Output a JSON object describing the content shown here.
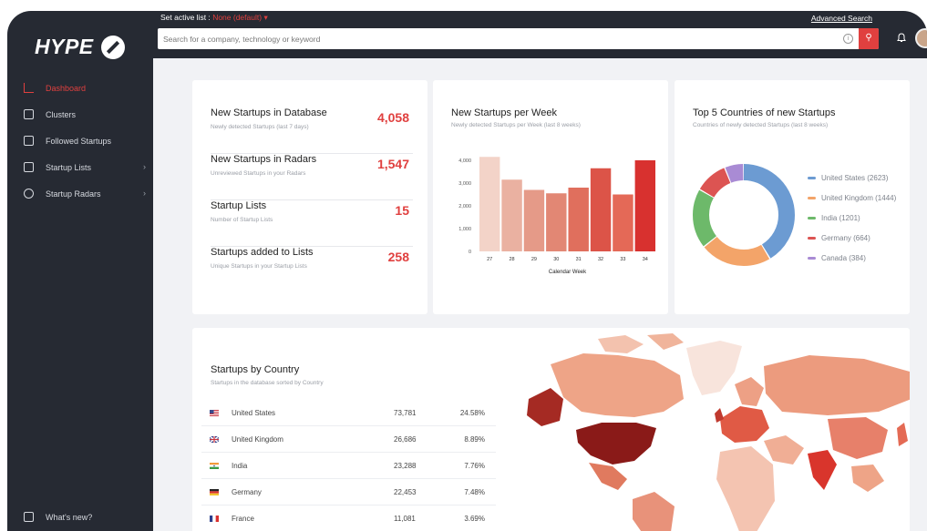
{
  "sidebar": {
    "logo": "HYPE",
    "items": [
      {
        "label": "Dashboard",
        "active": true
      },
      {
        "label": "Clusters"
      },
      {
        "label": "Followed Startups"
      },
      {
        "label": "Startup Lists",
        "chevron": "›"
      },
      {
        "label": "Startup Radars",
        "chevron": "›"
      }
    ],
    "whats_new": "What's new?"
  },
  "topbar": {
    "active_list_label": "Set active list :",
    "active_list_value": "None (default)",
    "active_list_caret": "▾",
    "advanced_search": "Advanced Search",
    "search_placeholder": "Search for a company, technology or keyword",
    "info_glyph": "i",
    "search_glyph": "⚲"
  },
  "stats": [
    {
      "title": "New Startups in Database",
      "sub": "Newly detected Startups (last 7 days)",
      "value": "4,058"
    },
    {
      "title": "New Startups in Radars",
      "sub": "Unreviewed Startups in your Radars",
      "value": "1,547"
    },
    {
      "title": "Startup Lists",
      "sub": "Number of Startup Lists",
      "value": "15"
    },
    {
      "title": "Startups added to Lists",
      "sub": "Unique Startups in your Startup Lists",
      "value": "258"
    }
  ],
  "weekly": {
    "title": "New Startups per Week",
    "sub": "Newly detected Startups per Week (last 8 weeks)",
    "xlabel": "Calendar Week",
    "ytick_labels": [
      "0",
      "1,000",
      "2,000",
      "3,000",
      "4,000"
    ],
    "chart_data": {
      "type": "bar",
      "categories": [
        "27",
        "28",
        "29",
        "30",
        "31",
        "32",
        "33",
        "34"
      ],
      "values": [
        4150,
        3150,
        2700,
        2550,
        2800,
        3650,
        2500,
        4000
      ],
      "ylim": [
        0,
        4000
      ],
      "xlabel": "Calendar Week",
      "colors": [
        "#f3d3c8",
        "#eab1a1",
        "#e59a88",
        "#e28774",
        "#e06f5d",
        "#dc5448",
        "#e46957",
        "#d8312f"
      ]
    }
  },
  "countries_top5": {
    "title": "Top 5 Countries of new Startups",
    "sub": "Countries of newly detected Startups (last 8 weeks)",
    "chart_data": {
      "type": "pie",
      "categories": [
        "United States",
        "United Kingdom",
        "India",
        "Germany",
        "Canada"
      ],
      "values": [
        2623,
        1444,
        1201,
        664,
        384
      ],
      "colors": [
        "#6c9bd2",
        "#f3a469",
        "#6db96a",
        "#dc5452",
        "#a98bd4"
      ]
    },
    "legend": [
      {
        "label": "United States (2623)",
        "color": "#6c9bd2"
      },
      {
        "label": "United Kingdom (1444)",
        "color": "#f3a469"
      },
      {
        "label": "India (1201)",
        "color": "#6db96a"
      },
      {
        "label": "Germany (664)",
        "color": "#dc5452"
      },
      {
        "label": "Canada (384)",
        "color": "#a98bd4"
      }
    ]
  },
  "by_country": {
    "title": "Startups by Country",
    "sub": "Startups in the database sorted by Country",
    "rows": [
      {
        "name": "United States",
        "count": "73,781",
        "pct": "24.58%",
        "flag": "us-flag"
      },
      {
        "name": "United Kingdom",
        "count": "26,686",
        "pct": "8.89%",
        "flag": "uk-flag"
      },
      {
        "name": "India",
        "count": "23,288",
        "pct": "7.76%",
        "flag": "india-flag"
      },
      {
        "name": "Germany",
        "count": "22,453",
        "pct": "7.48%",
        "flag": "germany-flag"
      },
      {
        "name": "France",
        "count": "11,081",
        "pct": "3.69%",
        "flag": "france-flag"
      }
    ]
  },
  "colors": {
    "accent": "#e0403f",
    "sidebar": "#262a33",
    "background": "#f1f2f5"
  }
}
